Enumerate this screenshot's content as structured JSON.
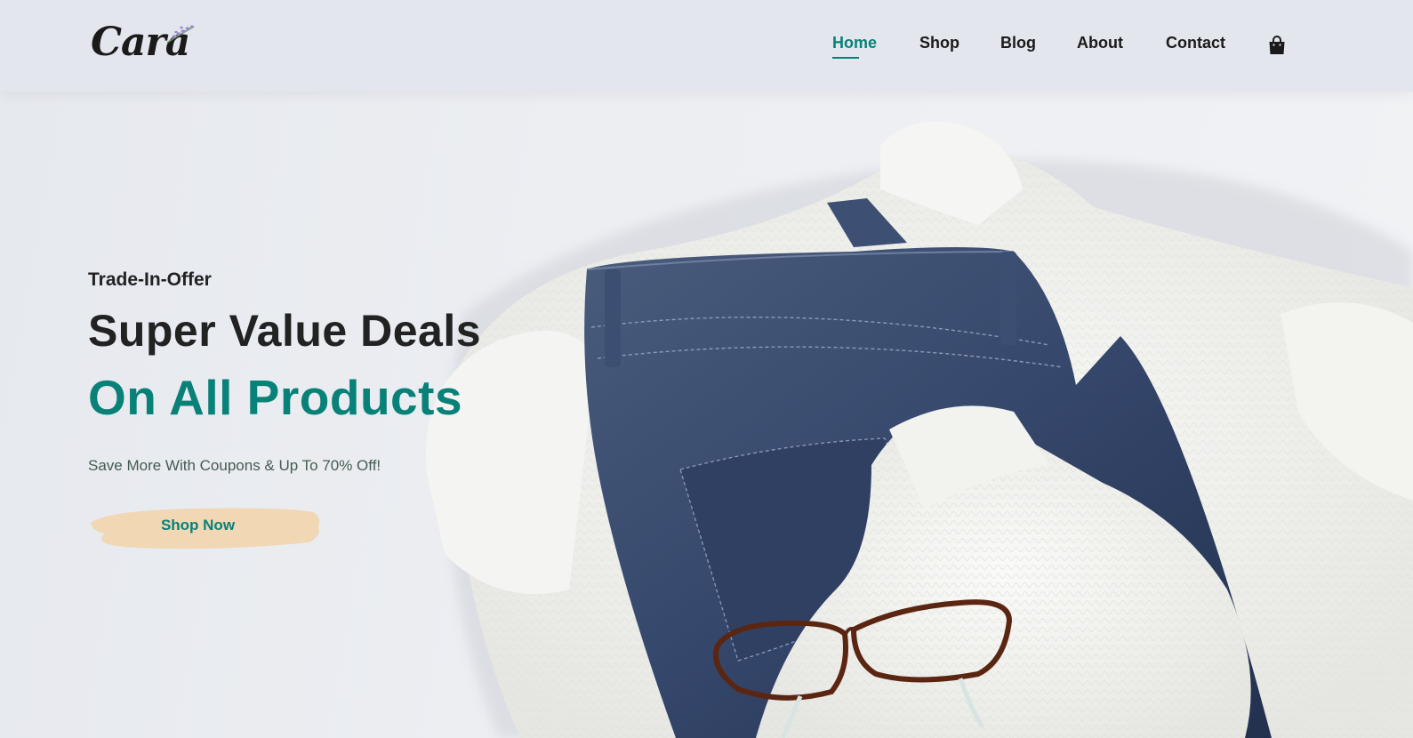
{
  "brand": {
    "logo_text": "Cara"
  },
  "nav": {
    "items": [
      {
        "label": "Home",
        "active": true
      },
      {
        "label": "Shop",
        "active": false
      },
      {
        "label": "Blog",
        "active": false
      },
      {
        "label": "About",
        "active": false
      },
      {
        "label": "Contact",
        "active": false
      }
    ],
    "cart_icon": "shopping-bag-icon"
  },
  "hero": {
    "kicker": "Trade-In-Offer",
    "headline": "Super Value Deals",
    "highlight": "On All Products",
    "subtext": "Save More With Coupons & Up To 70% Off!",
    "cta_label": "Shop Now",
    "image": "folded jeans, white knit sweater and glasses"
  },
  "colors": {
    "accent": "#088178",
    "cta_brush": "#f1d7b4",
    "header_bg": "#e3e6ec",
    "text_dark": "#222222"
  }
}
